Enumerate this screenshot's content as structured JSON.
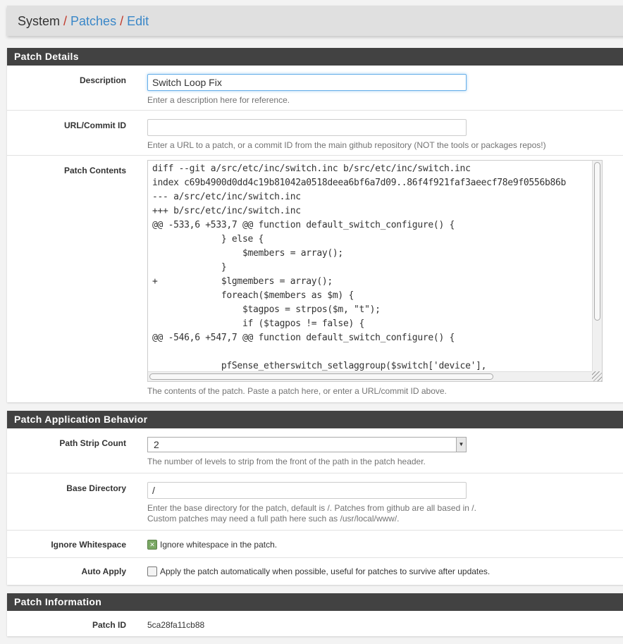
{
  "breadcrumb": {
    "root": "System",
    "items": [
      "Patches",
      "Edit"
    ]
  },
  "sections": {
    "details": {
      "title": "Patch Details",
      "description": {
        "label": "Description",
        "value": "Switch Loop Fix",
        "help": "Enter a description here for reference."
      },
      "url": {
        "label": "URL/Commit ID",
        "value": "",
        "help": "Enter a URL to a patch, or a commit ID from the main github repository (NOT the tools or packages repos!)"
      },
      "contents": {
        "label": "Patch Contents",
        "help": "The contents of the patch. Paste a patch here, or enter a URL/commit ID above.",
        "lines": [
          "diff --git a/src/etc/inc/switch.inc b/src/etc/inc/switch.inc",
          "index c69b4900d0dd4c19b81042a0518deea6bf6a7d09..86f4f921faf3aeecf78e9f0556b86b",
          "--- a/src/etc/inc/switch.inc",
          "+++ b/src/etc/inc/switch.inc",
          "@@ -533,6 +533,7 @@ function default_switch_configure() {",
          "             } else {",
          "                 $members = array();",
          "             }",
          "+            $lgmembers = array();",
          "             foreach($members as $m) {",
          "                 $tagpos = strpos($m, \"t\");",
          "                 if ($tagpos != false) {",
          "@@ -546,6 +547,7 @@ function default_switch_configure() {",
          "",
          "             pfSense_etherswitch_setlaggroup($switch['device'],"
        ]
      }
    },
    "behavior": {
      "title": "Patch Application Behavior",
      "strip": {
        "label": "Path Strip Count",
        "value": "2",
        "help": "The number of levels to strip from the front of the path in the patch header."
      },
      "basedir": {
        "label": "Base Directory",
        "value": "/",
        "help1": "Enter the base directory for the patch, default is /. Patches from github are all based in /.",
        "help2": "Custom patches may need a full path here such as /usr/local/www/."
      },
      "ignore_ws": {
        "label": "Ignore Whitespace",
        "text": "Ignore whitespace in the patch.",
        "checked": true
      },
      "auto_apply": {
        "label": "Auto Apply",
        "text": "Apply the patch automatically when possible, useful for patches to survive after updates.",
        "checked": false
      }
    },
    "info": {
      "title": "Patch Information",
      "patch_id": {
        "label": "Patch ID",
        "value": "5ca28fa11cb88"
      }
    }
  }
}
